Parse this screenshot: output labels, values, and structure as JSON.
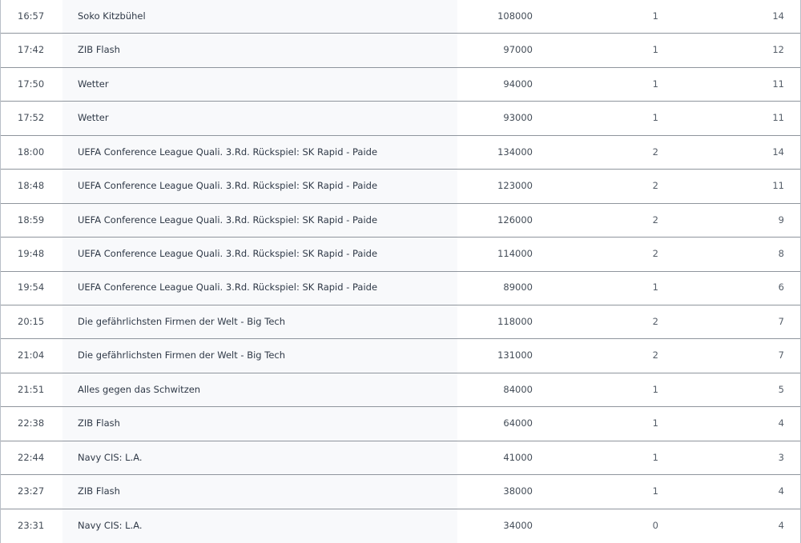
{
  "rows": [
    {
      "time": "16:57",
      "title": "Soko Kitzbühel",
      "viewers": "108000",
      "share": "1",
      "rank": "14"
    },
    {
      "time": "17:42",
      "title": "ZIB Flash",
      "viewers": "97000",
      "share": "1",
      "rank": "12"
    },
    {
      "time": "17:50",
      "title": "Wetter",
      "viewers": "94000",
      "share": "1",
      "rank": "11"
    },
    {
      "time": "17:52",
      "title": "Wetter",
      "viewers": "93000",
      "share": "1",
      "rank": "11"
    },
    {
      "time": "18:00",
      "title": "UEFA Conference League Quali. 3.Rd. Rückspiel: SK Rapid - Paide",
      "viewers": "134000",
      "share": "2",
      "rank": "14"
    },
    {
      "time": "18:48",
      "title": "UEFA Conference League Quali. 3.Rd. Rückspiel: SK Rapid - Paide",
      "viewers": "123000",
      "share": "2",
      "rank": "11"
    },
    {
      "time": "18:59",
      "title": "UEFA Conference League Quali. 3.Rd. Rückspiel: SK Rapid - Paide",
      "viewers": "126000",
      "share": "2",
      "rank": "9"
    },
    {
      "time": "19:48",
      "title": "UEFA Conference League Quali. 3.Rd. Rückspiel: SK Rapid - Paide",
      "viewers": "114000",
      "share": "2",
      "rank": "8"
    },
    {
      "time": "19:54",
      "title": "UEFA Conference League Quali. 3.Rd. Rückspiel: SK Rapid - Paide",
      "viewers": "89000",
      "share": "1",
      "rank": "6"
    },
    {
      "time": "20:15",
      "title": "Die gefährlichsten Firmen der Welt - Big Tech",
      "viewers": "118000",
      "share": "2",
      "rank": "7"
    },
    {
      "time": "21:04",
      "title": "Die gefährlichsten Firmen der Welt - Big Tech",
      "viewers": "131000",
      "share": "2",
      "rank": "7"
    },
    {
      "time": "21:51",
      "title": "Alles gegen das Schwitzen",
      "viewers": "84000",
      "share": "1",
      "rank": "5"
    },
    {
      "time": "22:38",
      "title": "ZIB Flash",
      "viewers": "64000",
      "share": "1",
      "rank": "4"
    },
    {
      "time": "22:44",
      "title": "Navy CIS: L.A.",
      "viewers": "41000",
      "share": "1",
      "rank": "3"
    },
    {
      "time": "23:27",
      "title": "ZIB Flash",
      "viewers": "38000",
      "share": "1",
      "rank": "4"
    },
    {
      "time": "23:31",
      "title": "Navy CIS: L.A.",
      "viewers": "34000",
      "share": "0",
      "rank": "4"
    }
  ]
}
